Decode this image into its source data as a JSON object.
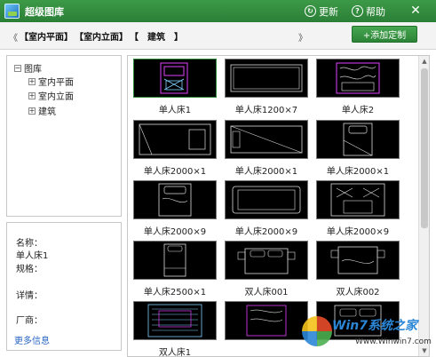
{
  "window": {
    "title": "超级图库",
    "refresh_label": "更新",
    "help_label": "帮助",
    "close_label": "✕",
    "accent_color": "#2f8a3b"
  },
  "tabbar": {
    "left_arrow": "《",
    "right_arrow": "》",
    "tabs": [
      "【室内平面】",
      "【室内立面】",
      "【　建筑　】"
    ],
    "add_button_label": "+添加定制"
  },
  "tree": {
    "root": {
      "toggle": "−",
      "label": "图库"
    },
    "children": [
      {
        "toggle": "+",
        "label": "室内平面"
      },
      {
        "toggle": "+",
        "label": "室内立面"
      },
      {
        "toggle": "+",
        "label": "建筑"
      }
    ]
  },
  "details": {
    "name_label": "名称：",
    "name_value": "单人床1",
    "spec_label": "规格：",
    "detail_label": "详情：",
    "vendor_label": "厂商：",
    "more_link": "更多信息"
  },
  "gallery": {
    "items": [
      {
        "caption": "单人床1",
        "selected": true
      },
      {
        "caption": "单人床1200×7",
        "selected": false
      },
      {
        "caption": "单人床2",
        "selected": false
      },
      {
        "caption": "单人床2000×1",
        "selected": false
      },
      {
        "caption": "单人床2000×1",
        "selected": false
      },
      {
        "caption": "单人床2000×1",
        "selected": false
      },
      {
        "caption": "单人床2000×9",
        "selected": false
      },
      {
        "caption": "单人床2000×9",
        "selected": false
      },
      {
        "caption": "单人床2000×9",
        "selected": false
      },
      {
        "caption": "单人床2500×1",
        "selected": false
      },
      {
        "caption": "双人床001",
        "selected": false
      },
      {
        "caption": "双人床002",
        "selected": false
      },
      {
        "caption": "双人床1",
        "selected": false
      },
      {
        "caption": "",
        "selected": false
      },
      {
        "caption": "",
        "selected": false
      }
    ]
  },
  "scrollbar": {
    "up": "▲",
    "down": "▼"
  },
  "watermark": {
    "line1": "Win7系统之家",
    "line2": "Www.Winwin7.com"
  }
}
